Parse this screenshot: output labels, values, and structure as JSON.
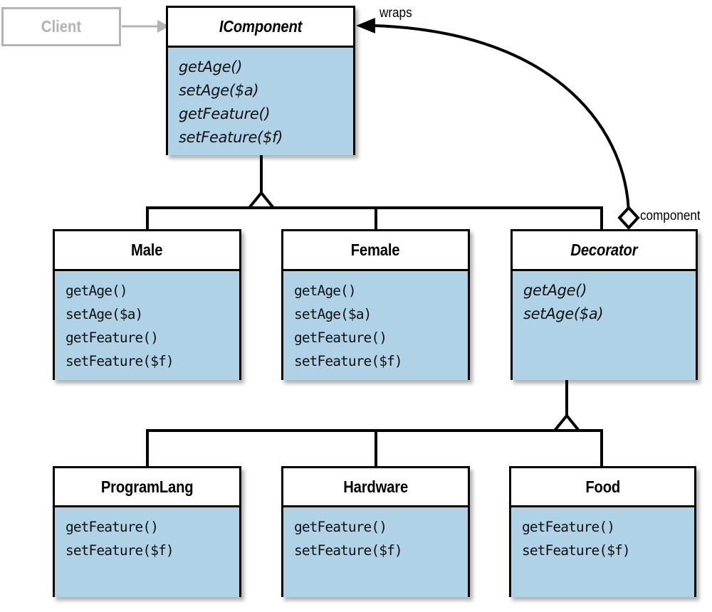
{
  "diagram": {
    "kind": "uml-class-diagram",
    "title": "Decorator pattern class diagram",
    "colors": {
      "box_fill": "#b0d2e6",
      "box_border": "#000000",
      "header_fill": "#ffffff",
      "greyed": "#b3b3b3",
      "background": "#ffffff"
    }
  },
  "client": {
    "label": "Client"
  },
  "classes": [
    {
      "id": "icomponent",
      "name": "IComponent",
      "abstract": true,
      "methods": [
        "getAge()",
        "setAge($a)",
        "getFeature()",
        "setFeature($f)"
      ]
    },
    {
      "id": "male",
      "name": "Male",
      "abstract": false,
      "methods": [
        "getAge()",
        "setAge($a)",
        "getFeature()",
        "setFeature($f)"
      ]
    },
    {
      "id": "female",
      "name": "Female",
      "abstract": false,
      "methods": [
        "getAge()",
        "setAge($a)",
        "getFeature()",
        "setFeature($f)"
      ]
    },
    {
      "id": "decorator",
      "name": "Decorator",
      "abstract": true,
      "methods": [
        "getAge()",
        "setAge($a)"
      ]
    },
    {
      "id": "programlang",
      "name": "ProgramLang",
      "abstract": false,
      "methods": [
        "getFeature()",
        "setFeature($f)"
      ]
    },
    {
      "id": "hardware",
      "name": "Hardware",
      "abstract": false,
      "methods": [
        "getFeature()",
        "setFeature($f)"
      ]
    },
    {
      "id": "food",
      "name": "Food",
      "abstract": false,
      "methods": [
        "getFeature()",
        "setFeature($f)"
      ]
    }
  ],
  "edges": {
    "wraps_label": "wraps",
    "component_label": "component"
  }
}
